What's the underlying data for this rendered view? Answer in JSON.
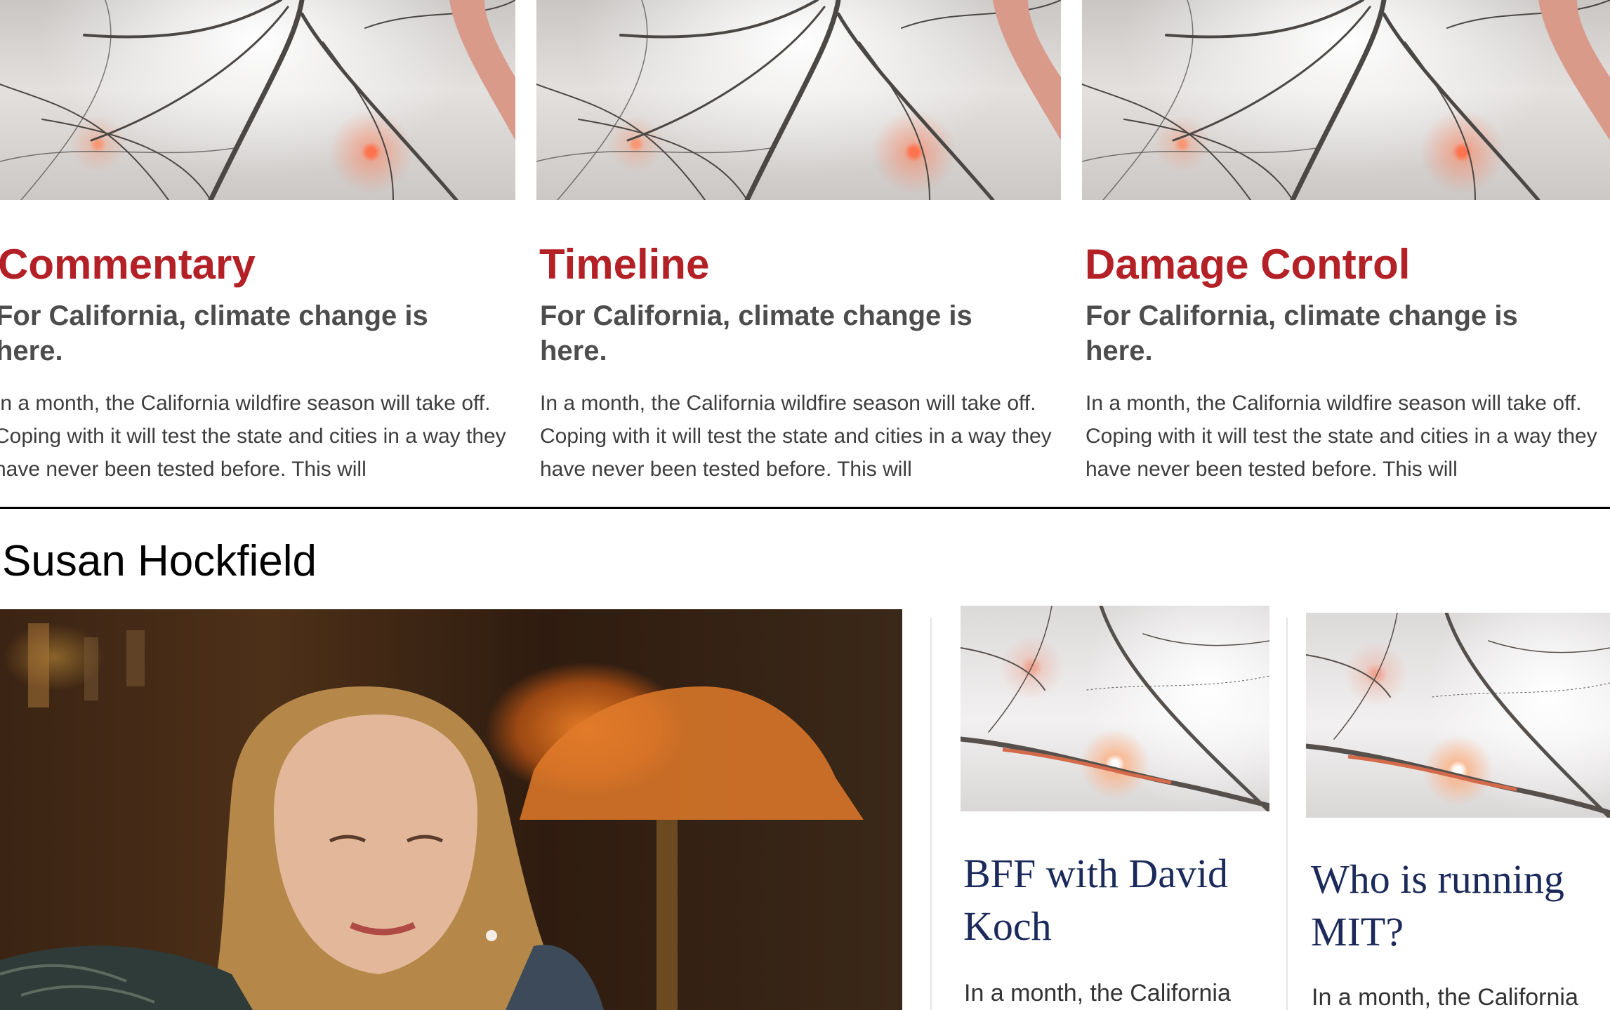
{
  "cards": [
    {
      "category": "Commentary",
      "headline": "For California, climate change is here.",
      "excerpt": "In a month, the California wildfire season will take off. Coping with it will test the state and cities in a way they have never been tested before. This will",
      "image_icon": "neuron-image"
    },
    {
      "category": "Timeline",
      "headline": "For California, climate change is here.",
      "excerpt": "In a month, the California wildfire season will take off. Coping with it will test the state and cities in a way they have never been tested before. This will",
      "image_icon": "neuron-image"
    },
    {
      "category": "Damage Control",
      "headline": "For California, climate change is here.",
      "excerpt": "In a month, the California wildfire season will take off. Coping with it will test the state and cities in a way they have never been tested before. This will",
      "image_icon": "neuron-image"
    }
  ],
  "section": {
    "title": "Susan Hockfield",
    "feature_image": "portrait-photo",
    "side_stories": [
      {
        "title": "BFF with David Koch",
        "excerpt": "In a month, the California"
      },
      {
        "title": "Who is running MIT?",
        "excerpt": "In a month, the California"
      }
    ]
  },
  "colors": {
    "category_red": "#b32127",
    "headline_gray": "#4d4d4d",
    "side_title_navy": "#1b2a5a"
  }
}
